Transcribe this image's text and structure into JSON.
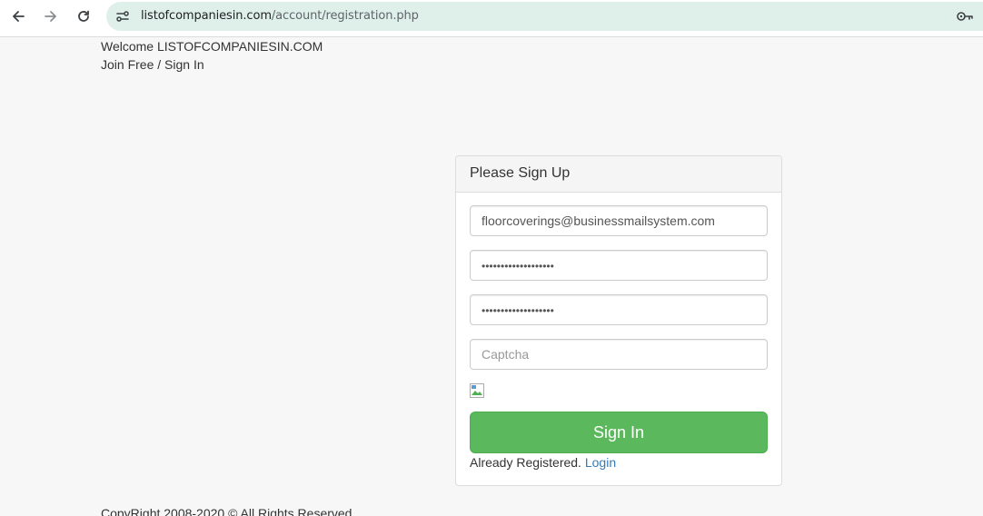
{
  "browser": {
    "url_host": "listofcompaniesin.com",
    "url_path": "/account/registration.php"
  },
  "header": {
    "welcome": "Welcome LISTOFCOMPANIESIN.COM",
    "join_link": "Join Free / Sign In"
  },
  "form": {
    "title": "Please Sign Up",
    "email_value": "floorcoverings@businessmailsystem.com",
    "password_value": "•••••••••••••••••••",
    "confirm_password_value": "•••••••••••••••••••",
    "captcha_placeholder": "Captcha",
    "submit_label": "Sign In",
    "already_text": "Already Registered.",
    "login_link": "Login"
  },
  "footer": {
    "copyright": "CopyRight 2008-2020 © All Rights Reserved"
  },
  "colors": {
    "omnibox": "#dff0ea",
    "button": "#5cb85c",
    "link": "#337ab7"
  },
  "icons": [
    "back-arrow-icon",
    "forward-arrow-icon",
    "reload-icon",
    "site-info-icon",
    "password-key-icon",
    "broken-image-icon"
  ]
}
